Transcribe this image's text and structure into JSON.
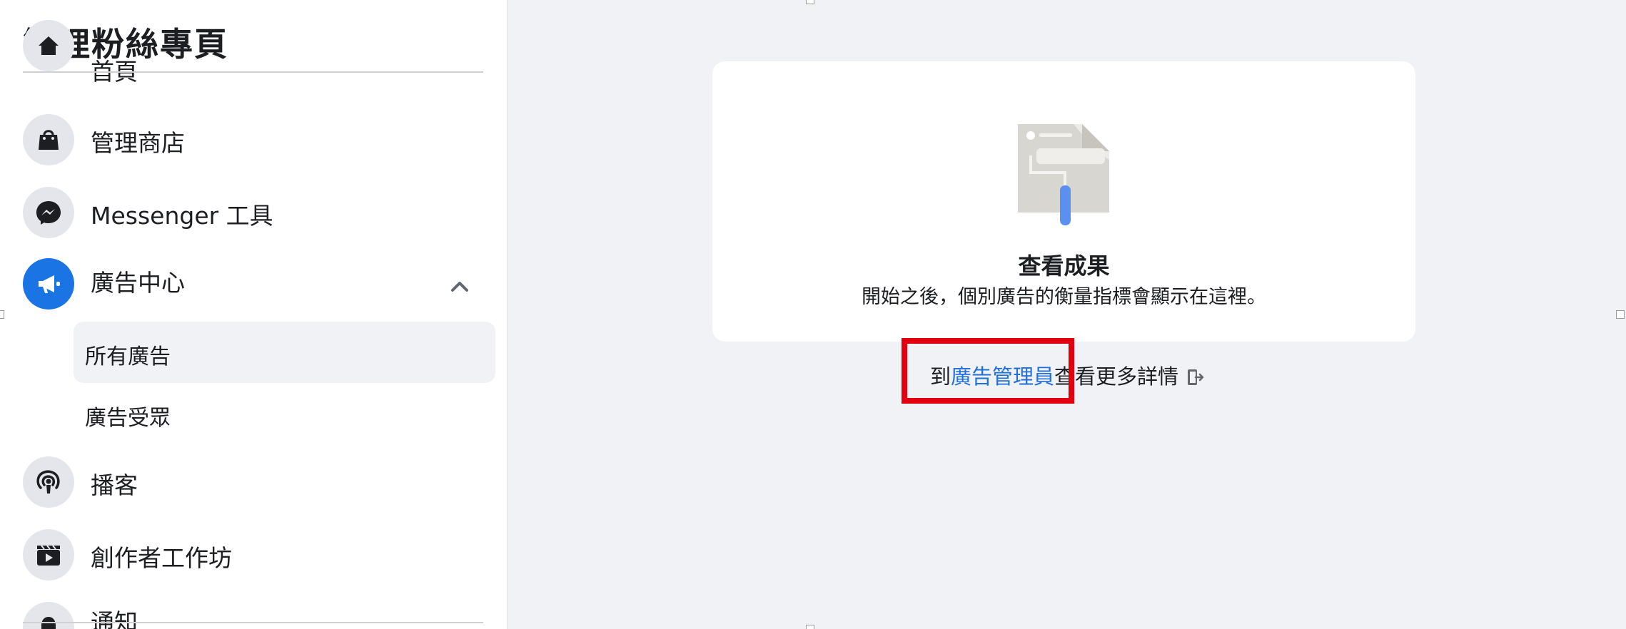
{
  "sidebar": {
    "title": "管理粉絲專頁",
    "items": [
      {
        "label": "首頁",
        "icon": "home-icon"
      },
      {
        "label": "管理商店",
        "icon": "shopping-bag-icon"
      },
      {
        "label": "Messenger 工具",
        "icon": "messenger-icon"
      },
      {
        "label": "廣告中心",
        "icon": "megaphone-icon",
        "expanded": true
      },
      {
        "label": "播客",
        "icon": "podcast-icon"
      },
      {
        "label": "創作者工作坊",
        "icon": "clapperboard-icon"
      },
      {
        "label": "通知",
        "icon": "bell-icon"
      }
    ],
    "ad_center_sub": [
      {
        "label": "所有廣告",
        "selected": true
      },
      {
        "label": "廣告受眾",
        "selected": false
      }
    ]
  },
  "main": {
    "card": {
      "title": "查看成果",
      "description": "開始之後，個別廣告的衡量指標會顯示在這裡。"
    },
    "ads_manager_line": {
      "prefix": "到",
      "link": "廣告管理員",
      "suffix": "查看更多詳情"
    }
  },
  "colors": {
    "accent": "#1b74e4",
    "link": "#216fdb",
    "highlight": "#e3000f",
    "main_background": "#f0f2f5"
  }
}
